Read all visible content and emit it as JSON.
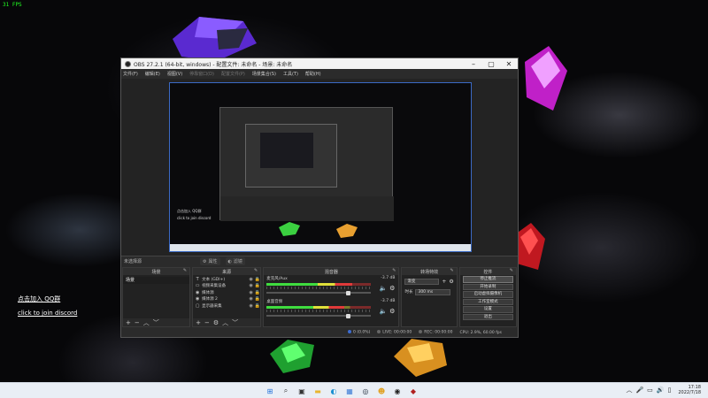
{
  "desktop": {
    "fps_counter": "31 FPS",
    "links": {
      "qq": "点击加入 QQ群",
      "discord": "click to join discord"
    }
  },
  "obs": {
    "title": "OBS 27.2.1 (64-bit, windows) - 配置文件: 未命名 - 场景: 未命名",
    "menu": [
      "文件(F)",
      "编辑(E)",
      "视图(V)",
      "停靠窗口(D)",
      "配置文件(P)",
      "场景集合(S)",
      "工具(T)",
      "帮助(H)"
    ],
    "menu_disabled": [
      3,
      4
    ],
    "toolbar": {
      "no_source": "未选择源",
      "properties": "属性",
      "filters": "滤镜"
    },
    "docks": {
      "scenes": {
        "title": "场景",
        "items": [
          "场景"
        ]
      },
      "sources": {
        "title": "来源",
        "items": [
          {
            "icon": "text-icon",
            "glyph": "T",
            "label": "文本 (GDI+)"
          },
          {
            "icon": "video-capture-icon",
            "glyph": "▭",
            "label": "视频采集设备"
          },
          {
            "icon": "media-source-icon",
            "glyph": "◉",
            "label": "媒体源"
          },
          {
            "icon": "media-source-icon",
            "glyph": "◉",
            "label": "媒体源 2"
          },
          {
            "icon": "display-capture-icon",
            "glyph": "▢",
            "label": "显示器采集"
          }
        ]
      },
      "mixer": {
        "title": "混音器",
        "channels": [
          {
            "name": "麦克风/Aux",
            "db": "-3.7 dB",
            "level": 0.82,
            "volume": 0.78
          },
          {
            "name": "桌面音频",
            "db": "-3.7 dB",
            "level": 0.74,
            "volume": 0.78
          }
        ]
      },
      "transitions": {
        "title": "转场特效",
        "selected": "渐变",
        "duration_label": "时长",
        "duration": "300 ms"
      },
      "controls": {
        "title": "控件",
        "buttons": [
          "停止推流",
          "开始录制",
          "启动虚拟摄像机",
          "工作室模式",
          "设置",
          "退出"
        ]
      }
    },
    "status": {
      "dropped": "0 (0.0%)",
      "live": "LIVE: 00:00:00",
      "rec": "REC: 00:00:00",
      "cpu": "CPU: 2.9%, 60.00 fps"
    }
  },
  "taskbar": {
    "apps": [
      {
        "name": "windows-start-icon",
        "glyph": "⊞",
        "color": "#1e6fd9"
      },
      {
        "name": "search-icon",
        "glyph": "⌕",
        "color": "#333333"
      },
      {
        "name": "task-view-icon",
        "glyph": "▣",
        "color": "#333333"
      },
      {
        "name": "file-explorer-icon",
        "glyph": "▬",
        "color": "#e8b530"
      },
      {
        "name": "edge-icon",
        "glyph": "◐",
        "color": "#1a8fd1"
      },
      {
        "name": "store-icon",
        "glyph": "▦",
        "color": "#3a7bd5"
      },
      {
        "name": "steam-icon",
        "glyph": "◎",
        "color": "#1b2838"
      },
      {
        "name": "app-yellow-icon",
        "glyph": "☻",
        "color": "#e0a020"
      },
      {
        "name": "obs-taskbar-icon",
        "glyph": "◉",
        "color": "#222222"
      },
      {
        "name": "app-red-icon",
        "glyph": "◆",
        "color": "#b02020"
      }
    ],
    "time": "17:18",
    "date": "2022/7/18"
  }
}
